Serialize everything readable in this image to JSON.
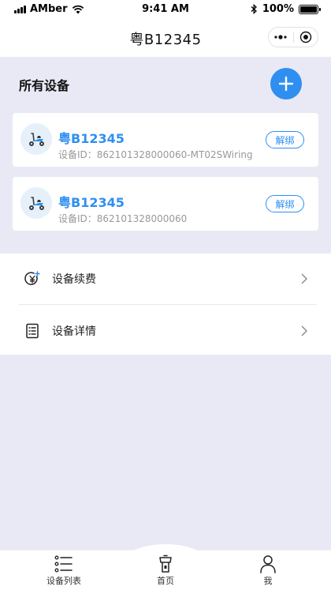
{
  "status_bar": {
    "carrier": "AMber",
    "time": "9:41 AM",
    "battery": "100%"
  },
  "nav": {
    "title": "粤B12345"
  },
  "devices_section": {
    "title": "所有设备"
  },
  "devices": [
    {
      "name": "粤B12345",
      "id_text": "设备ID：862101328000060-MT02SWiring",
      "unbind_label": "解绑"
    },
    {
      "name": "粤B12345",
      "id_text": "设备ID：862101328000060",
      "unbind_label": "解绑"
    }
  ],
  "menu": {
    "items": [
      {
        "label": "设备续费",
        "icon": "yuan-plus-icon"
      },
      {
        "label": "设备详情",
        "icon": "document-list-icon"
      }
    ]
  },
  "tab_bar": {
    "tabs": [
      {
        "label": "设备列表",
        "icon": "list-icon"
      },
      {
        "label": "首页",
        "icon": "home-icon"
      },
      {
        "label": "我",
        "icon": "person-icon"
      }
    ]
  },
  "colors": {
    "accent": "#2f8ff0",
    "background": "#e9e9f6"
  }
}
